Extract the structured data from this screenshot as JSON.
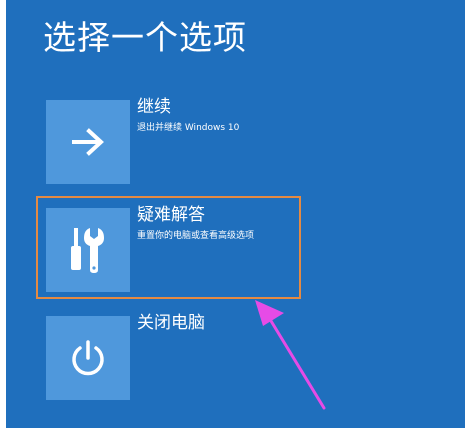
{
  "screen": {
    "title": "选择一个选项"
  },
  "options": [
    {
      "title": "继续",
      "subtitle": "退出并继续 Windows 10",
      "icon": "arrow-right-icon"
    },
    {
      "title": "疑难解答",
      "subtitle": "重置你的电脑或查看高级选项",
      "icon": "tools-icon"
    },
    {
      "title": "关闭电脑",
      "subtitle": "",
      "icon": "power-icon"
    }
  ],
  "colors": {
    "background": "#1f6fbd",
    "tile": "#4f98dc",
    "highlight": "#e58a42",
    "annotation_arrow": "#e64be6"
  }
}
